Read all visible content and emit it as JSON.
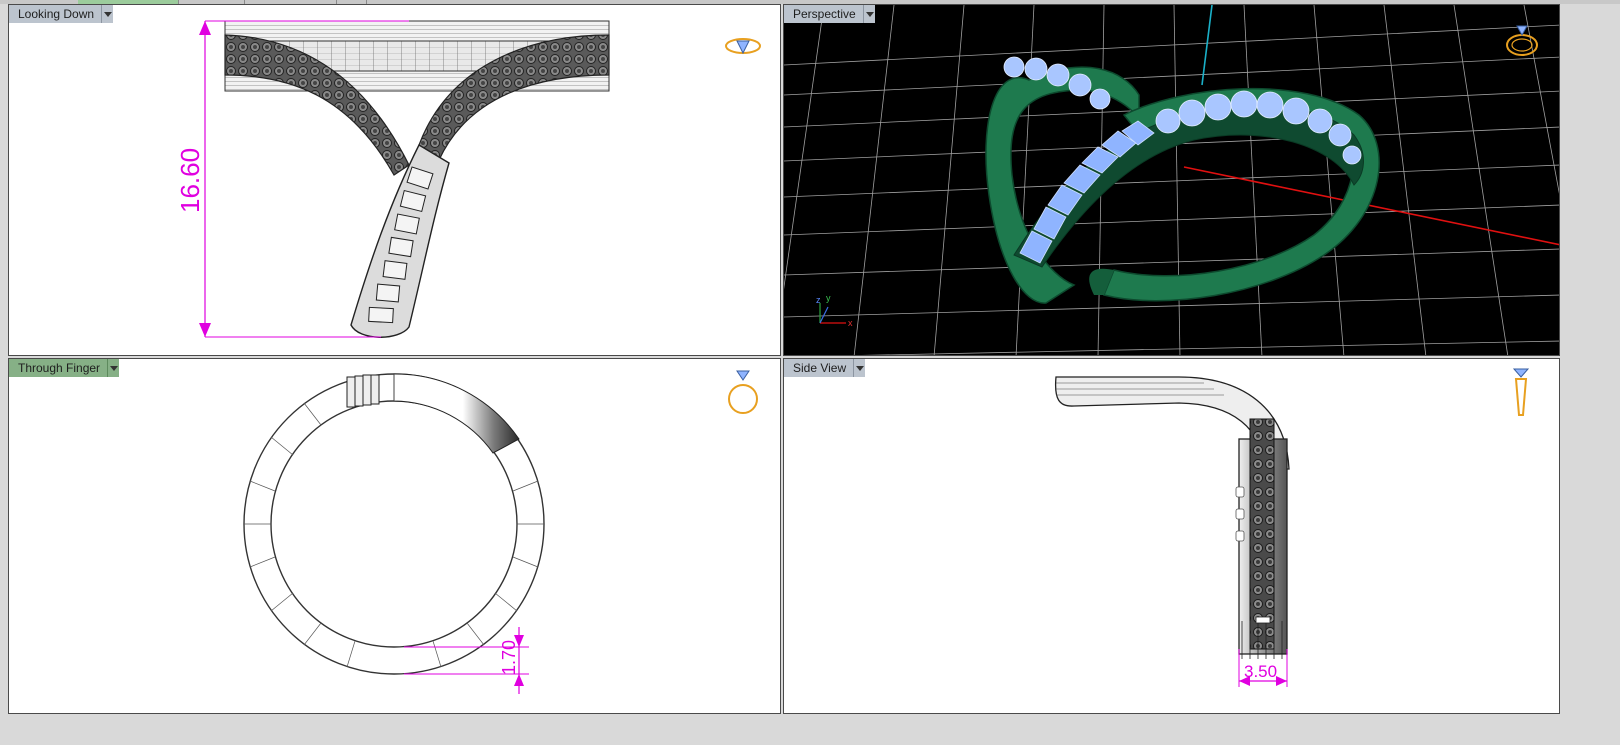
{
  "viewports": {
    "top_left": {
      "label": "Looking Down",
      "dimension": "16.60",
      "icon": "ring-top-icon"
    },
    "top_right": {
      "label": "Perspective",
      "icon": "ring-perspective-icon",
      "axes": {
        "x": "x",
        "y": "y",
        "z": "z"
      }
    },
    "bottom_left": {
      "label": "Through Finger",
      "dimension": "1.70",
      "icon": "ring-front-icon",
      "active": true
    },
    "bottom_right": {
      "label": "Side View",
      "dimension": "3.50",
      "icon": "ring-side-icon"
    }
  },
  "colors": {
    "dimension": "#e000e0",
    "perspective_bg": "#000000",
    "metal_green": "#1e7a4e",
    "gem_blue": "#8fb4ff",
    "active_tab": "#86b086",
    "inactive_tab": "#bcc4ce"
  }
}
